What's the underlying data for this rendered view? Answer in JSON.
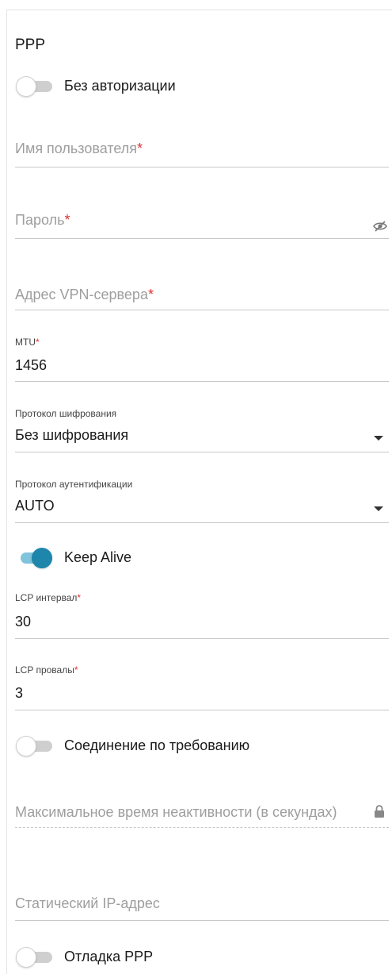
{
  "section": {
    "title": "PPP"
  },
  "no_auth": {
    "label": "Без авторизации",
    "enabled": false
  },
  "username": {
    "placeholder": "Имя пользователя",
    "required": "*"
  },
  "password": {
    "placeholder": "Пароль",
    "required": "*",
    "icon": "eye-off-icon"
  },
  "vpn_server": {
    "placeholder": "Адрес VPN-сервера",
    "required": "*"
  },
  "mtu": {
    "label": "MTU",
    "required": "*",
    "value": "1456"
  },
  "encryption": {
    "label": "Протокол шифрования",
    "value": "Без шифрования"
  },
  "auth_protocol": {
    "label": "Протокол аутентификации",
    "value": "AUTO"
  },
  "keep_alive": {
    "label": "Keep Alive",
    "enabled": true
  },
  "lcp_interval": {
    "label": "LCP интервал",
    "required": "*",
    "value": "30"
  },
  "lcp_fails": {
    "label": "LCP провалы",
    "required": "*",
    "value": "3"
  },
  "on_demand": {
    "label": "Соединение по требованию",
    "enabled": false
  },
  "max_idle": {
    "placeholder": "Максимальное время неактивности (в секундах)",
    "icon": "lock-icon"
  },
  "static_ip": {
    "placeholder": "Статический IP-адрес"
  },
  "ppp_debug": {
    "label": "Отладка PPP",
    "enabled": false
  },
  "colors": {
    "accent": "#1f86ab",
    "accent_light": "#7fc3dd",
    "required": "#dd3333"
  }
}
